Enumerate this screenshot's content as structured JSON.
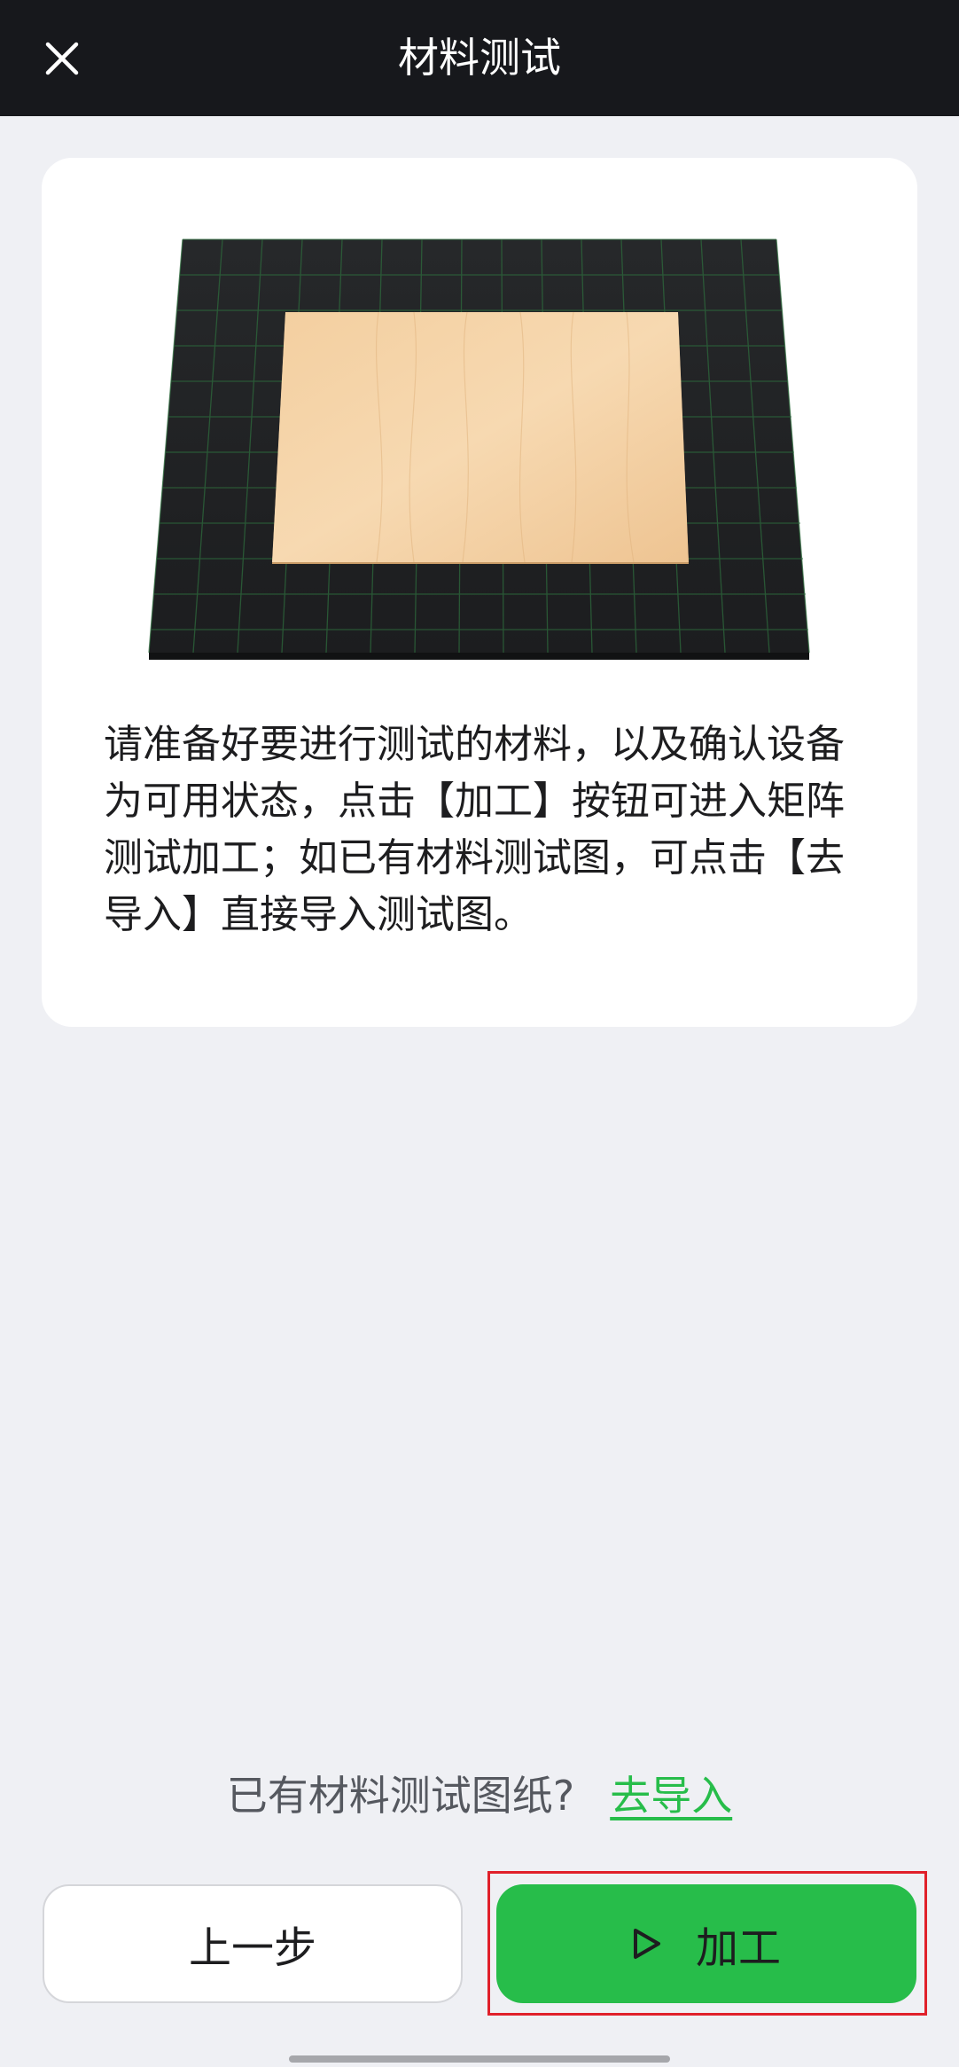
{
  "header": {
    "title": "材料测试",
    "close_icon": "close-icon"
  },
  "card": {
    "illustration": "wood-board-on-grid-mat",
    "instruction": "请准备好要进行测试的材料，以及确认设备为可用状态，点击【加工】按钮可进入矩阵测试加工；如已有材料测试图，可点击【去导入】直接导入测试图。"
  },
  "import": {
    "question": "已有材料测试图纸?",
    "link_label": "去导入"
  },
  "buttons": {
    "prev_label": "上一步",
    "process_label": "加工",
    "process_icon": "play-icon"
  },
  "colors": {
    "header_bg": "#17181c",
    "page_bg": "#eff0f4",
    "accent_green": "#27bd4a",
    "highlight_red": "#e0202a"
  }
}
